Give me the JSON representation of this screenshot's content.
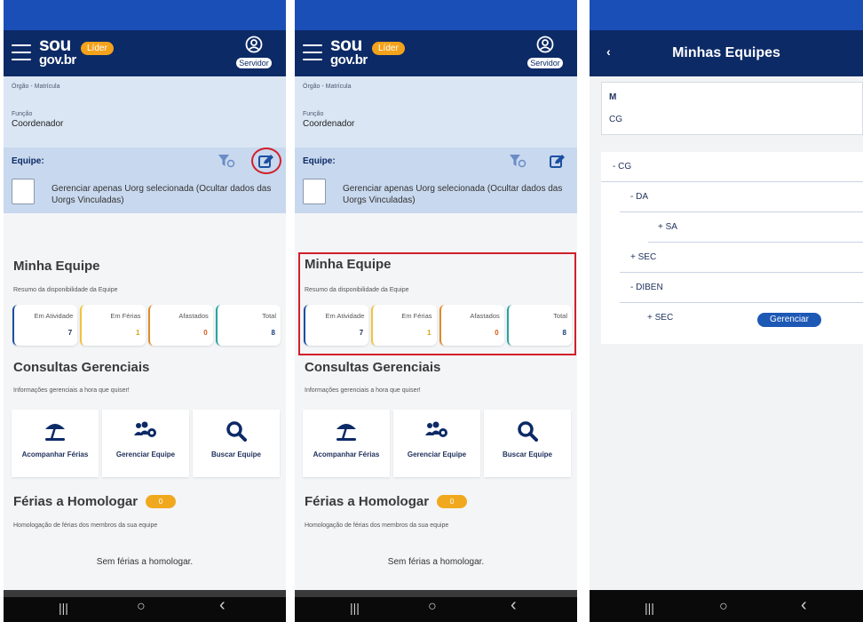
{
  "brand": {
    "line1": "sou",
    "line2": "gov.br",
    "lider": "Líder",
    "servidor": "Servidor"
  },
  "info": {
    "orgao_label": "Órgão - Matrícula",
    "funcao_label": "Função",
    "funcao_value": "Coordenador"
  },
  "equipe": {
    "title": "Equipe:",
    "checkbox_label": "Gerenciar apenas Uorg selecionada (Ocultar dados das Uorgs Vinculadas)"
  },
  "minha_equipe": {
    "title": "Minha Equipe",
    "subtitle": "Resumo da disponibilidade da Equipe",
    "cards": [
      {
        "label": "Em Atividade",
        "value": "7"
      },
      {
        "label": "Em Férias",
        "value": "1"
      },
      {
        "label": "Afastados",
        "value": "0"
      },
      {
        "label": "Total",
        "value": "8"
      }
    ]
  },
  "consultas": {
    "title": "Consultas Gerenciais",
    "subtitle": "Informações gerenciais a hora que quiser!",
    "tiles": [
      {
        "label": "Acompanhar Férias",
        "icon": "beach-umbrella-icon"
      },
      {
        "label": "Gerenciar Equipe",
        "icon": "users-gear-icon"
      },
      {
        "label": "Buscar Equipe",
        "icon": "search-icon"
      }
    ]
  },
  "ferias": {
    "title": "Férias a Homologar",
    "badge": "0",
    "subtitle": "Homologação de férias dos membros da sua equipe",
    "empty": "Sem férias a homologar."
  },
  "navbar": {
    "recent": "|||",
    "home": "○",
    "back": "‹"
  },
  "minhas_equipes": {
    "back": "‹",
    "title": "Minhas Equipes",
    "card_m": "M",
    "card_cg": "CG",
    "tree": [
      {
        "label": "- CG"
      },
      {
        "label": "- DA"
      },
      {
        "label": "+ SA"
      },
      {
        "label": "+ SEC"
      },
      {
        "label": "- DIBEN"
      },
      {
        "label": "+ SEC"
      }
    ],
    "gerenciar": "Gerenciar"
  },
  "colors": {
    "header": "#0c2a66",
    "status": "#1b4fb8",
    "accent": "#f0a91e",
    "highlight": "#d0202a"
  }
}
